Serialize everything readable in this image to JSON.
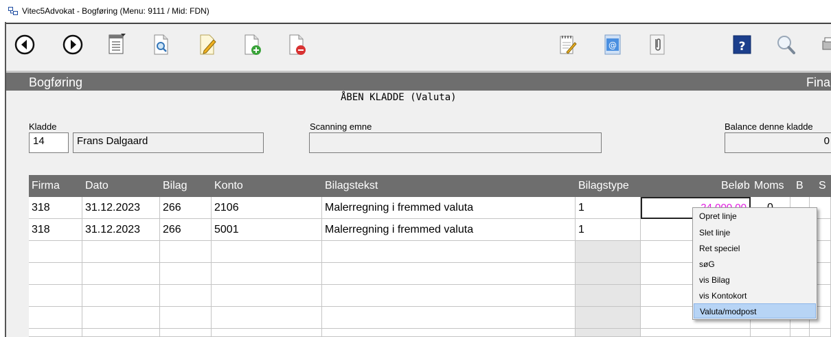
{
  "window": {
    "title": "Vitec5Advokat - Bogføring (Menu: 9111 / Mid: FDN)"
  },
  "toolbar": {
    "icons": [
      "back-icon",
      "forward-icon",
      "list-menu-icon",
      "preview-icon",
      "edit-icon",
      "new-document-icon",
      "delete-document-icon",
      "notepad-icon",
      "email-icon",
      "attachment-icon",
      "help-icon",
      "search-icon"
    ]
  },
  "section": {
    "title": "Bogføring",
    "right_label": "Fina"
  },
  "form": {
    "subtitle": "ÅBEN KLADDE (Valuta)",
    "kladde_label": "Kladde",
    "kladde_number": "14",
    "kladde_name": "Frans Dalgaard",
    "scanning_label": "Scanning emne",
    "scanning_value": "",
    "balance_label": "Balance denne kladde",
    "balance_value": "0"
  },
  "grid": {
    "columns": [
      "Firma",
      "Dato",
      "Bilag",
      "Konto",
      "Bilagstekst",
      "Bilagstype",
      "Beløb",
      "Moms",
      "B",
      "S"
    ],
    "rows": [
      {
        "firma": "318",
        "dato": "31.12.2023",
        "bilag": "266",
        "konto": "2106",
        "tekst": "Malerregning i fremmed valuta",
        "type": "1",
        "belob": "-24.000,00",
        "moms": "0"
      },
      {
        "firma": "318",
        "dato": "31.12.2023",
        "bilag": "266",
        "konto": "5001",
        "tekst": "Malerregning i fremmed valuta",
        "type": "1",
        "belob": "",
        "moms": ""
      }
    ]
  },
  "context_menu": {
    "items": [
      "Opret linje",
      "Slet linje",
      "Ret speciel",
      "søG",
      "vis Bilag",
      "vis Kontokort",
      "Valuta/modpost"
    ],
    "selected": "Valuta/modpost"
  },
  "colors": {
    "header_bg": "#6e6e6e",
    "highlight": "#b7d4f5",
    "amount_text": "#e01be0"
  }
}
